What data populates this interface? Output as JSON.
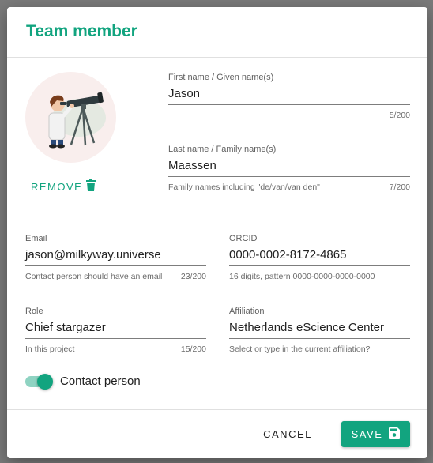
{
  "dialog": {
    "title": "Team member",
    "accent_color": "#12a47f"
  },
  "avatar": {
    "icon": "astronomer-with-telescope-illustration",
    "remove_label": "REMOVE",
    "remove_icon": "trash-icon"
  },
  "fields": {
    "first_name": {
      "label": "First name / Given name(s)",
      "value": "Jason",
      "helper": "",
      "counter": "5/200"
    },
    "last_name": {
      "label": "Last name / Family name(s)",
      "value": "Maassen",
      "helper": "Family names including \"de/van/van den\"",
      "counter": "7/200"
    },
    "email": {
      "label": "Email",
      "value": "jason@milkyway.universe",
      "helper": "Contact person should have an email",
      "counter": "23/200"
    },
    "orcid": {
      "label": "ORCID",
      "value": "0000-0002-8172-4865",
      "helper": "16 digits, pattern 0000-0000-0000-0000",
      "counter": ""
    },
    "role": {
      "label": "Role",
      "value": "Chief stargazer",
      "helper": "In this project",
      "counter": "15/200"
    },
    "affiliation": {
      "label": "Affiliation",
      "value": "Netherlands eScience Center",
      "helper": "Select or type in the current affiliation?",
      "counter": ""
    }
  },
  "contact_toggle": {
    "label": "Contact person",
    "checked": true
  },
  "actions": {
    "cancel_label": "CANCEL",
    "save_label": "SAVE",
    "save_icon": "floppy-disk-icon"
  }
}
